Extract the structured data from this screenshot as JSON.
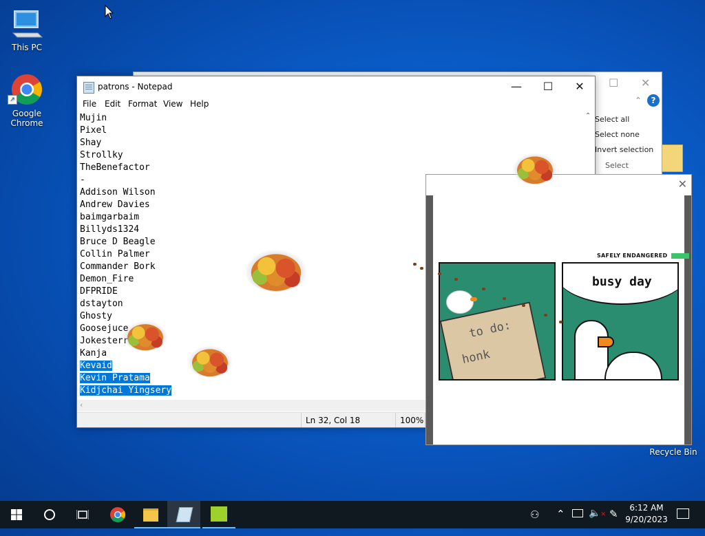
{
  "desktop": {
    "icons": [
      {
        "name": "This PC"
      },
      {
        "name": "Google Chrome"
      },
      {
        "name": "Recycle Bin"
      }
    ]
  },
  "explorer": {
    "ribbon": [
      "Select all",
      "Select none",
      "Invert selection",
      "Select"
    ]
  },
  "notepad": {
    "title": "patrons - Notepad",
    "menu": [
      "File",
      "Edit",
      "Format",
      "View",
      "Help"
    ],
    "lines": [
      {
        "text": "Mujin",
        "selected": false
      },
      {
        "text": "Pixel",
        "selected": false
      },
      {
        "text": "Shay",
        "selected": false
      },
      {
        "text": "Strollky",
        "selected": false
      },
      {
        "text": "TheBenefactor",
        "selected": false
      },
      {
        "text": "-",
        "selected": false
      },
      {
        "text": "Addison Wilson",
        "selected": false
      },
      {
        "text": "Andrew Davies",
        "selected": false
      },
      {
        "text": "baimgarbaim",
        "selected": false
      },
      {
        "text": "Billyds1324",
        "selected": false
      },
      {
        "text": "Bruce D Beagle",
        "selected": false
      },
      {
        "text": "Collin Palmer",
        "selected": false
      },
      {
        "text": "Commander Bork",
        "selected": false
      },
      {
        "text": "Demon_Fire",
        "selected": false
      },
      {
        "text": "DFPRIDE",
        "selected": false
      },
      {
        "text": "dstayton",
        "selected": false
      },
      {
        "text": "Ghosty",
        "selected": false
      },
      {
        "text": "Goosejuce",
        "selected": false
      },
      {
        "text": "Jokesterr",
        "selected": false
      },
      {
        "text": "Kanja",
        "selected": false
      },
      {
        "text": "Kevaid",
        "selected": true
      },
      {
        "text": "Kevin Pratama",
        "selected": true
      },
      {
        "text": "Kidjchai Yingsery",
        "selected": true
      }
    ],
    "status": {
      "position": "Ln 32, Col 18",
      "zoom": "100%"
    }
  },
  "comic": {
    "header": "SAFELY ENDANGERED",
    "panel1_text": [
      "to do:",
      "honk"
    ],
    "panel2_text": "busy day"
  },
  "taskbar": {
    "time": "6:12 AM",
    "date": "9/20/2023"
  },
  "colors": {
    "selection": "#0078d7",
    "panel_green": "#2a8d6f",
    "taskbar": "#101820"
  }
}
